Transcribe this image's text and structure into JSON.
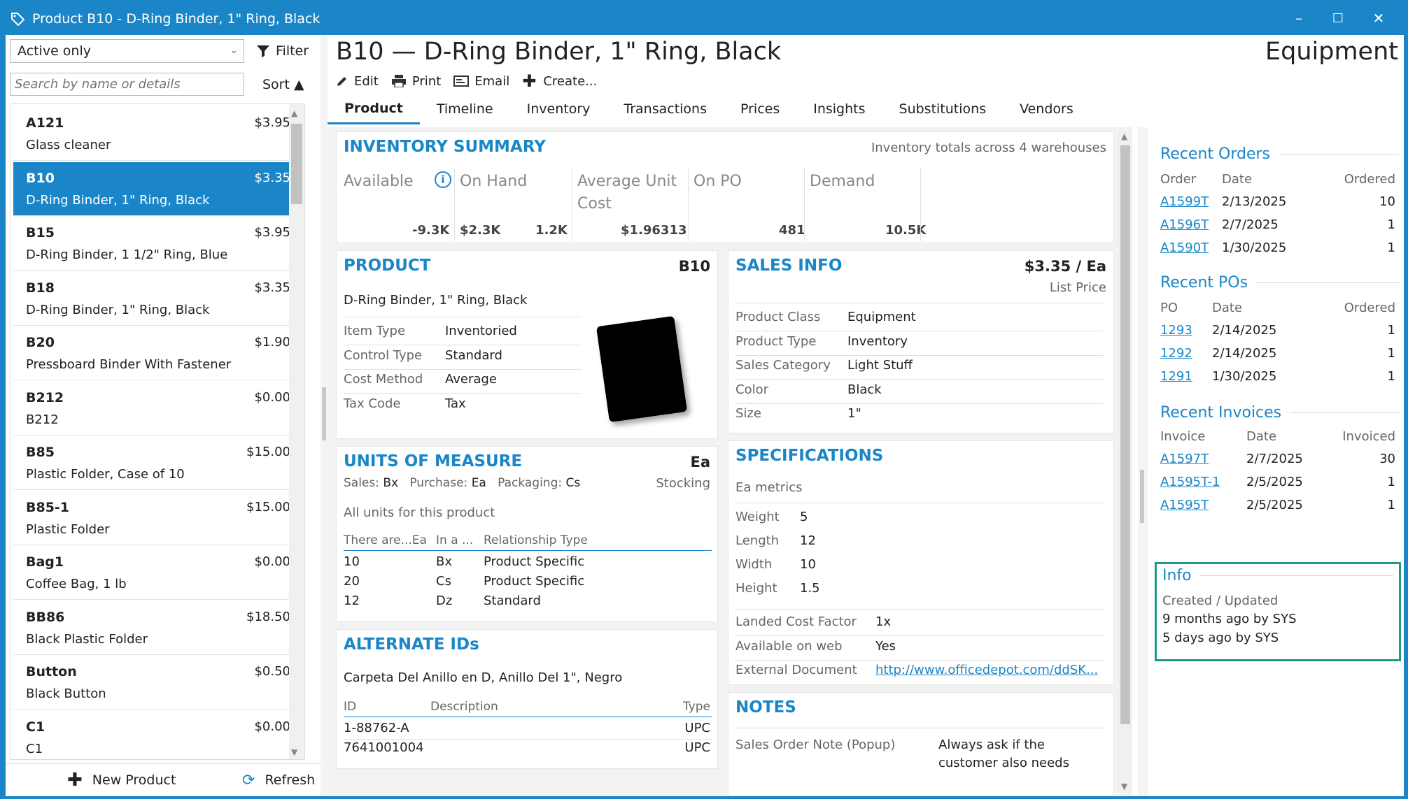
{
  "window": {
    "title": "Product B10 - D-Ring Binder, 1\" Ring, Black",
    "minimize": "–",
    "maximize": "☐",
    "close": "✕"
  },
  "left": {
    "filter_select": "Active only",
    "filter_label": "Filter",
    "search_placeholder": "Search by name or details",
    "sort_label": "Sort ▲",
    "items": [
      {
        "code": "A121",
        "price": "$3.95",
        "desc": "Glass cleaner"
      },
      {
        "code": "B10",
        "price": "$3.35",
        "desc": "D-Ring Binder, 1\" Ring, Black"
      },
      {
        "code": "B15",
        "price": "$3.95",
        "desc": "D-Ring Binder, 1 1/2\" Ring, Blue"
      },
      {
        "code": "B18",
        "price": "$3.35",
        "desc": "D-Ring Binder, 1\" Ring, Black"
      },
      {
        "code": "B20",
        "price": "$1.90",
        "desc": "Pressboard Binder With Fastener"
      },
      {
        "code": "B212",
        "price": "$0.00",
        "desc": "B212"
      },
      {
        "code": "B85",
        "price": "$15.00",
        "desc": "Plastic Folder, Case of 10"
      },
      {
        "code": "B85-1",
        "price": "$15.00",
        "desc": "Plastic Folder"
      },
      {
        "code": "Bag1",
        "price": "$0.00",
        "desc": "Coffee Bag, 1 lb"
      },
      {
        "code": "BB86",
        "price": "$18.50",
        "desc": "Black Plastic Folder"
      },
      {
        "code": "Button",
        "price": "$0.50",
        "desc": "Black Button"
      },
      {
        "code": "C1",
        "price": "$0.00",
        "desc": "C1"
      }
    ],
    "new_product": "New Product",
    "refresh": "Refresh"
  },
  "header": {
    "title": "B10 — D-Ring Binder, 1\" Ring, Black",
    "class": "Equipment"
  },
  "toolbar": {
    "edit": "Edit",
    "print": "Print",
    "email": "Email",
    "create": "Create..."
  },
  "tabs": [
    "Product",
    "Timeline",
    "Inventory",
    "Transactions",
    "Prices",
    "Insights",
    "Substitutions",
    "Vendors"
  ],
  "inventory": {
    "title": "INVENTORY SUMMARY",
    "note": "Inventory totals across 4 warehouses",
    "available_label": "Available",
    "available_value": "-9.3K",
    "onhand_label": "On Hand",
    "onhand_value1": "$2.3K",
    "onhand_value2": "1.2K",
    "avgcost_label1": "Average Unit",
    "avgcost_label2": "Cost",
    "avgcost_value": "$1.96313",
    "onpo_label": "On PO",
    "onpo_value": "481",
    "demand_label": "Demand",
    "demand_value": "10.5K"
  },
  "product": {
    "title": "PRODUCT",
    "code": "B10",
    "desc": "D-Ring Binder, 1\" Ring, Black",
    "rows": [
      {
        "label": "Item Type",
        "value": "Inventoried"
      },
      {
        "label": "Control Type",
        "value": "Standard"
      },
      {
        "label": "Cost Method",
        "value": "Average"
      },
      {
        "label": "Tax Code",
        "value": "Tax"
      }
    ]
  },
  "sales": {
    "title": "SALES INFO",
    "price": "$3.35 / Ea",
    "price_label": "List Price",
    "rows": [
      {
        "label": "Product Class",
        "value": "Equipment"
      },
      {
        "label": "Product Type",
        "value": "Inventory"
      },
      {
        "label": "Sales Category",
        "value": "Light Stuff"
      },
      {
        "label": "Color",
        "value": "Black"
      },
      {
        "label": "Size",
        "value": "1\""
      }
    ]
  },
  "uom": {
    "title": "UNITS OF MEASURE",
    "unit": "Ea",
    "sales_label": "Sales:",
    "sales_value": "Bx",
    "purchase_label": "Purchase:",
    "purchase_value": "Ea",
    "packaging_label": "Packaging:",
    "packaging_value": "Cs",
    "stocking": "Stocking",
    "all_units": "All units for this product",
    "headers": [
      "There are...Ea",
      "In a ...",
      "Relationship Type"
    ],
    "rows": [
      [
        "10",
        "Bx",
        "Product Specific"
      ],
      [
        "20",
        "Cs",
        "Product Specific"
      ],
      [
        "12",
        "Dz",
        "Standard"
      ]
    ]
  },
  "specs": {
    "title": "SPECIFICATIONS",
    "metrics": "Ea metrics",
    "rows": [
      {
        "label": "Weight",
        "value": "5"
      },
      {
        "label": "Length",
        "value": "12"
      },
      {
        "label": "Width",
        "value": "10"
      },
      {
        "label": "Height",
        "value": "1.5"
      }
    ],
    "rows2": [
      {
        "label": "Landed Cost Factor",
        "value": "1x"
      },
      {
        "label": "Available on web",
        "value": "Yes"
      },
      {
        "label": "External Document",
        "value": "http://www.officedepot.com/ddSK..."
      }
    ]
  },
  "altids": {
    "title": "ALTERNATE IDs",
    "desc": "Carpeta Del Anillo en D, Anillo Del 1\", Negro",
    "headers": [
      "ID",
      "Description",
      "Type"
    ],
    "rows": [
      [
        "1-88762-A",
        "UPC"
      ],
      [
        "7641001004",
        "UPC"
      ]
    ]
  },
  "notes": {
    "title": "NOTES",
    "label": "Sales Order Note (Popup)",
    "value1": "Always ask if the",
    "value2": "customer also needs"
  },
  "recent_orders": {
    "title": "Recent Orders",
    "headers": [
      "Order",
      "Date",
      "Ordered"
    ],
    "rows": [
      [
        "A1599T",
        "2/13/2025",
        "10"
      ],
      [
        "A1596T",
        "2/7/2025",
        "1"
      ],
      [
        "A1590T",
        "1/30/2025",
        "1"
      ]
    ]
  },
  "recent_pos": {
    "title": "Recent POs",
    "headers": [
      "PO",
      "Date",
      "Ordered"
    ],
    "rows": [
      [
        "1293",
        "2/14/2025",
        "1"
      ],
      [
        "1292",
        "2/14/2025",
        "1"
      ],
      [
        "1291",
        "1/30/2025",
        "1"
      ]
    ]
  },
  "recent_invoices": {
    "title": "Recent Invoices",
    "headers": [
      "Invoice",
      "Date",
      "Invoiced"
    ],
    "rows": [
      [
        "A1597T",
        "2/7/2025",
        "30"
      ],
      [
        "A1595T-1",
        "2/5/2025",
        "1"
      ],
      [
        "A1595T",
        "2/5/2025",
        "1"
      ]
    ]
  },
  "info": {
    "title": "Info",
    "label": "Created / Updated",
    "created": "9 months ago by SYS",
    "updated": "5 days ago by SYS"
  }
}
